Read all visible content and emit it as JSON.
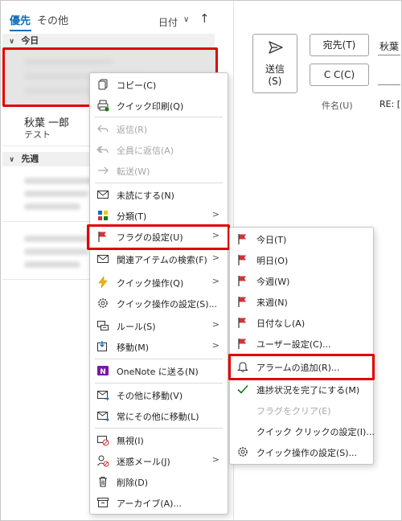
{
  "tabs": {
    "focused": "優先",
    "other": "その他"
  },
  "sort": {
    "label": "日付",
    "chevron": "∨",
    "arrow": "↑"
  },
  "groups": {
    "today": "今日",
    "last_week": "先週"
  },
  "messages": [
    {
      "sender": "秋葉 一郎",
      "preview": "テスト"
    }
  ],
  "compose": {
    "send_label_line1": "送信",
    "send_label_line2": "(S)",
    "to_button": "宛先(T)",
    "cc_button": "C C(C)",
    "to_value": "秋葉",
    "subject_label": "件名(U)",
    "subject_value": "RE: [",
    "accent": "#0f6cbd"
  },
  "context_menu": {
    "items": [
      {
        "label": "コピー(C)",
        "icon": "copy-icon"
      },
      {
        "label": "クイック印刷(Q)",
        "icon": "print-icon"
      },
      {
        "label": "返信(R)",
        "icon": "reply-icon",
        "disabled": true
      },
      {
        "label": "全員に返信(A)",
        "icon": "reply-all-icon",
        "disabled": true
      },
      {
        "label": "転送(W)",
        "icon": "forward-icon",
        "disabled": true
      },
      {
        "label": "未読にする(N)",
        "icon": "mail-unread-icon"
      },
      {
        "label": "分類(T)",
        "icon": "categorize-icon",
        "submenu": true
      },
      {
        "label": "フラグの設定(U)",
        "icon": "flag-icon",
        "submenu": true
      },
      {
        "label": "関連アイテムの検索(F)",
        "icon": "related-items-icon",
        "submenu": true
      },
      {
        "label": "クイック操作(Q)",
        "icon": "lightning-icon",
        "submenu": true
      },
      {
        "label": "クイック操作の設定(S)...",
        "icon": "gear-icon"
      },
      {
        "label": "ルール(S)",
        "icon": "rules-icon",
        "submenu": true
      },
      {
        "label": "移動(M)",
        "icon": "move-icon",
        "submenu": true
      },
      {
        "label": "OneNote に送る(N)",
        "icon": "onenote-icon"
      },
      {
        "label": "その他に移動(V)",
        "icon": "move-to-other-icon"
      },
      {
        "label": "常にその他に移動(L)",
        "icon": "always-move-to-other-icon"
      },
      {
        "label": "無視(I)",
        "icon": "ignore-icon"
      },
      {
        "label": "迷惑メール(J)",
        "icon": "junk-icon",
        "submenu": true
      },
      {
        "label": "削除(D)",
        "icon": "trash-icon"
      },
      {
        "label": "アーカイブ(A)...",
        "icon": "archive-icon"
      }
    ]
  },
  "flag_submenu": {
    "items": [
      {
        "label": "今日(T)",
        "icon": "flag-icon"
      },
      {
        "label": "明日(O)",
        "icon": "flag-icon"
      },
      {
        "label": "今週(W)",
        "icon": "flag-icon"
      },
      {
        "label": "来週(N)",
        "icon": "flag-icon"
      },
      {
        "label": "日付なし(A)",
        "icon": "flag-icon"
      },
      {
        "label": "ユーザー設定(C)...",
        "icon": "flag-icon"
      },
      {
        "label": "アラームの追加(R)...",
        "icon": "bell-icon"
      },
      {
        "label": "進捗状況を完了にする(M)",
        "icon": "check-icon"
      },
      {
        "label": "フラグをクリア(E)",
        "icon": "",
        "disabled": true
      },
      {
        "label": "クイック クリックの設定(I)...",
        "icon": ""
      },
      {
        "label": "クイック操作の設定(S)...",
        "icon": "gear-icon"
      }
    ]
  },
  "colors": {
    "highlight": "#e00000",
    "flag": "#d13438",
    "check": "#107c10",
    "onenote": "#7719aa"
  }
}
